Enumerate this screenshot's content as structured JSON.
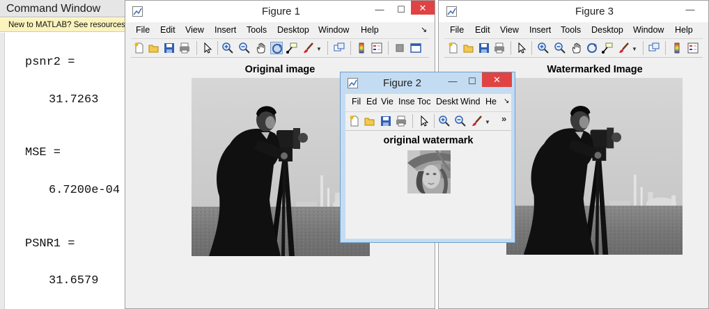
{
  "command_window": {
    "title": "Command Window",
    "banner": "New to MATLAB? See resources",
    "lines": [
      "psnr2 =",
      "31.7263",
      "MSE =",
      "6.7200e-04",
      "PSNR1 =",
      "31.6579"
    ]
  },
  "figure1": {
    "title": "Figure 1",
    "menus": [
      "File",
      "Edit",
      "View",
      "Insert",
      "Tools",
      "Desktop",
      "Window",
      "Help"
    ],
    "axes_title": "Original image"
  },
  "figure2": {
    "title": "Figure 2",
    "menus": [
      "Fil",
      "Ed",
      "Vie",
      "Inse",
      "Toc",
      "Deskt",
      "Wind",
      "He"
    ],
    "axes_title": "original watermark",
    "overflow": "»"
  },
  "figure3": {
    "title": "Figure 3",
    "menus": [
      "File",
      "Edit",
      "View",
      "Insert",
      "Tools",
      "Desktop",
      "Window",
      "Help"
    ],
    "axes_title": "Watermarked Image"
  },
  "window_buttons": {
    "minimize": "—",
    "maximize": "☐",
    "close": "✕"
  },
  "menu_dock_arrow": "↘",
  "icons": [
    "new-figure-icon",
    "open-file-icon",
    "save-icon",
    "print-icon",
    "pointer-icon",
    "zoom-in-icon",
    "zoom-out-icon",
    "pan-icon",
    "rotate-3d-icon",
    "data-cursor-icon",
    "brush-icon",
    "link-icon",
    "colorbar-icon",
    "legend-icon",
    "hide-plot-tools-icon",
    "show-plot-tools-icon"
  ],
  "colors": {
    "close_red": "#e04343",
    "active_title": "#c4dcf2",
    "banner": "#fbf3bd"
  }
}
